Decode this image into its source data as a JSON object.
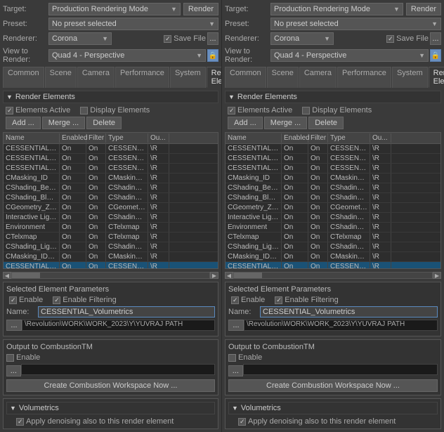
{
  "panels": [
    {
      "id": "left",
      "target": {
        "label": "Target:",
        "value": "Production Rendering Mode"
      },
      "preset": {
        "label": "Preset:",
        "value": "No preset selected"
      },
      "renderer": {
        "label": "Renderer:",
        "value": "Corona"
      },
      "render_btn": "Render",
      "save_file": "Save File",
      "view_to_render": {
        "label": "View to Render:",
        "value": "Quad 4 - Perspective"
      },
      "tabs": [
        "Common",
        "Scene",
        "Camera",
        "Performance",
        "System",
        "Render Elements"
      ],
      "active_tab": "Render Elements",
      "render_elements": {
        "section_title": "Render Elements",
        "elements_active": "Elements Active",
        "display_elements": "Display Elements",
        "buttons": [
          "Add ...",
          "Merge ...",
          "Delete"
        ],
        "columns": [
          "Name",
          "Enabled",
          "Filter",
          "Type",
          "Ou..."
        ],
        "rows": [
          {
            "name": "CESSENTIAL_Dir...",
            "enabled": "On",
            "filter": "On",
            "type": "CESSENTIAL_....",
            "out": "\\R"
          },
          {
            "name": "CESSENTIAL_In...",
            "enabled": "On",
            "filter": "On",
            "type": "CESSENTIAL_....",
            "out": "\\R"
          },
          {
            "name": "CESSENTIAL_Re...",
            "enabled": "On",
            "filter": "On",
            "type": "CESSENTIAL_....",
            "out": "\\R"
          },
          {
            "name": "CMasking_ID",
            "enabled": "On",
            "filter": "On",
            "type": "CMasking_ID",
            "out": "\\R"
          },
          {
            "name": "CShading_Beauty",
            "enabled": "On",
            "filter": "On",
            "type": "CShading_Blo...",
            "out": "\\R"
          },
          {
            "name": "CShading_Bloom...",
            "enabled": "On",
            "filter": "On",
            "type": "CShading_Blo...",
            "out": "\\R"
          },
          {
            "name": "CGeometry_ZDe...",
            "enabled": "On",
            "filter": "On",
            "type": "CGeometry_Z...",
            "out": "\\R"
          },
          {
            "name": "Interactive Light...",
            "enabled": "On",
            "filter": "On",
            "type": "CShading_Lig...",
            "out": "\\R"
          },
          {
            "name": "Environment",
            "enabled": "On",
            "filter": "On",
            "type": "CTelxmap",
            "out": "\\R"
          },
          {
            "name": "CTelxmap",
            "enabled": "On",
            "filter": "On",
            "type": "CTelxmap",
            "out": "\\R"
          },
          {
            "name": "CShading_LightS...",
            "enabled": "On",
            "filter": "On",
            "type": "CShading_Lig...",
            "out": "\\R"
          },
          {
            "name": "CMasking_ID001",
            "enabled": "On",
            "filter": "On",
            "type": "CMasking_ID",
            "out": "\\R"
          },
          {
            "name": "CESSENTIAL_Vol...",
            "enabled": "On",
            "filter": "On",
            "type": "CESSENTIAL_....",
            "out": "\\R",
            "selected": true
          }
        ]
      },
      "selected_element": {
        "title": "Selected Element Parameters",
        "enable": "Enable",
        "enable_filtering": "Enable Filtering",
        "name_label": "Name:",
        "name_value": "CESSENTIAL_Volumetrics",
        "path_value": "\\Revolution\\WORK\\WORK_2023\\Y\\YUVRAJ PATH"
      },
      "output_combustion": {
        "title": "Output to CombustionTM",
        "enable": "Enable",
        "create_btn": "Create Combustion Workspace Now ..."
      },
      "volumetrics": {
        "title": "Volumetrics",
        "note": "Apply denoising also to this render element"
      }
    },
    {
      "id": "right",
      "target": {
        "label": "Target:",
        "value": "Production Rendering Mode"
      },
      "preset": {
        "label": "Preset:",
        "value": "No preset selected"
      },
      "renderer": {
        "label": "Renderer:",
        "value": "Corona"
      },
      "render_btn": "Render",
      "save_file": "Save File",
      "view_to_render": {
        "label": "View to Render:",
        "value": "Quad 4 - Perspective"
      },
      "tabs": [
        "Common",
        "Scene",
        "Camera",
        "Performance",
        "System",
        "Render Elements"
      ],
      "active_tab": "Render Elements",
      "render_elements": {
        "section_title": "Render Elements",
        "elements_active": "Elements Active",
        "display_elements": "Display Elements",
        "buttons": [
          "Add ...",
          "Merge ...",
          "Delete"
        ],
        "columns": [
          "Name",
          "Enabled",
          "Filter",
          "Type",
          "Ou..."
        ],
        "rows": [
          {
            "name": "CESSENTIAL_Dir...",
            "enabled": "On",
            "filter": "On",
            "type": "CESSENTIAL_....",
            "out": "\\R"
          },
          {
            "name": "CESSENTIAL_In...",
            "enabled": "On",
            "filter": "On",
            "type": "CESSENTIAL_....",
            "out": "\\R"
          },
          {
            "name": "CESSENTIAL_Re...",
            "enabled": "On",
            "filter": "On",
            "type": "CESSENTIAL_....",
            "out": "\\R"
          },
          {
            "name": "CMasking_ID",
            "enabled": "On",
            "filter": "On",
            "type": "CMasking_ID",
            "out": "\\R"
          },
          {
            "name": "CShading_Beauty",
            "enabled": "On",
            "filter": "On",
            "type": "CShading_Be...",
            "out": "\\R"
          },
          {
            "name": "CShading_Bloom...",
            "enabled": "On",
            "filter": "On",
            "type": "CShading_Blo...",
            "out": "\\R"
          },
          {
            "name": "CGeometry_ZDe...",
            "enabled": "On",
            "filter": "On",
            "type": "CGeometry_Z...",
            "out": "\\R"
          },
          {
            "name": "Interactive Light...",
            "enabled": "On",
            "filter": "On",
            "type": "CShading_Lig...",
            "out": "\\R"
          },
          {
            "name": "Environment",
            "enabled": "On",
            "filter": "On",
            "type": "CShading_Lig...",
            "out": "\\R"
          },
          {
            "name": "CTelxmap",
            "enabled": "On",
            "filter": "On",
            "type": "CTelxmap",
            "out": "\\R"
          },
          {
            "name": "CShading_LightS...",
            "enabled": "On",
            "filter": "On",
            "type": "CShading_Lig...",
            "out": "\\R"
          },
          {
            "name": "CMasking_ID001",
            "enabled": "On",
            "filter": "On",
            "type": "CMasking_ID",
            "out": "\\R"
          },
          {
            "name": "CESSENTIAL_Vol...",
            "enabled": "On",
            "filter": "On",
            "type": "CESSENTIAL_....",
            "out": "\\R",
            "selected": true
          }
        ]
      },
      "selected_element": {
        "title": "Selected Element Parameters",
        "enable": "Enable",
        "enable_filtering": "Enable Filtering",
        "name_label": "Name:",
        "name_value": "CESSENTIAL_Volumetrics",
        "path_value": "\\Revolution\\WORK\\WORK_2023\\Y\\YUVRAJ PATH"
      },
      "output_combustion": {
        "title": "Output to CombustionTM",
        "enable": "Enable",
        "create_btn": "Create Combustion Workspace Now ..."
      },
      "volumetrics": {
        "title": "Volumetrics",
        "note": "Apply denoising also to this render element"
      }
    }
  ]
}
